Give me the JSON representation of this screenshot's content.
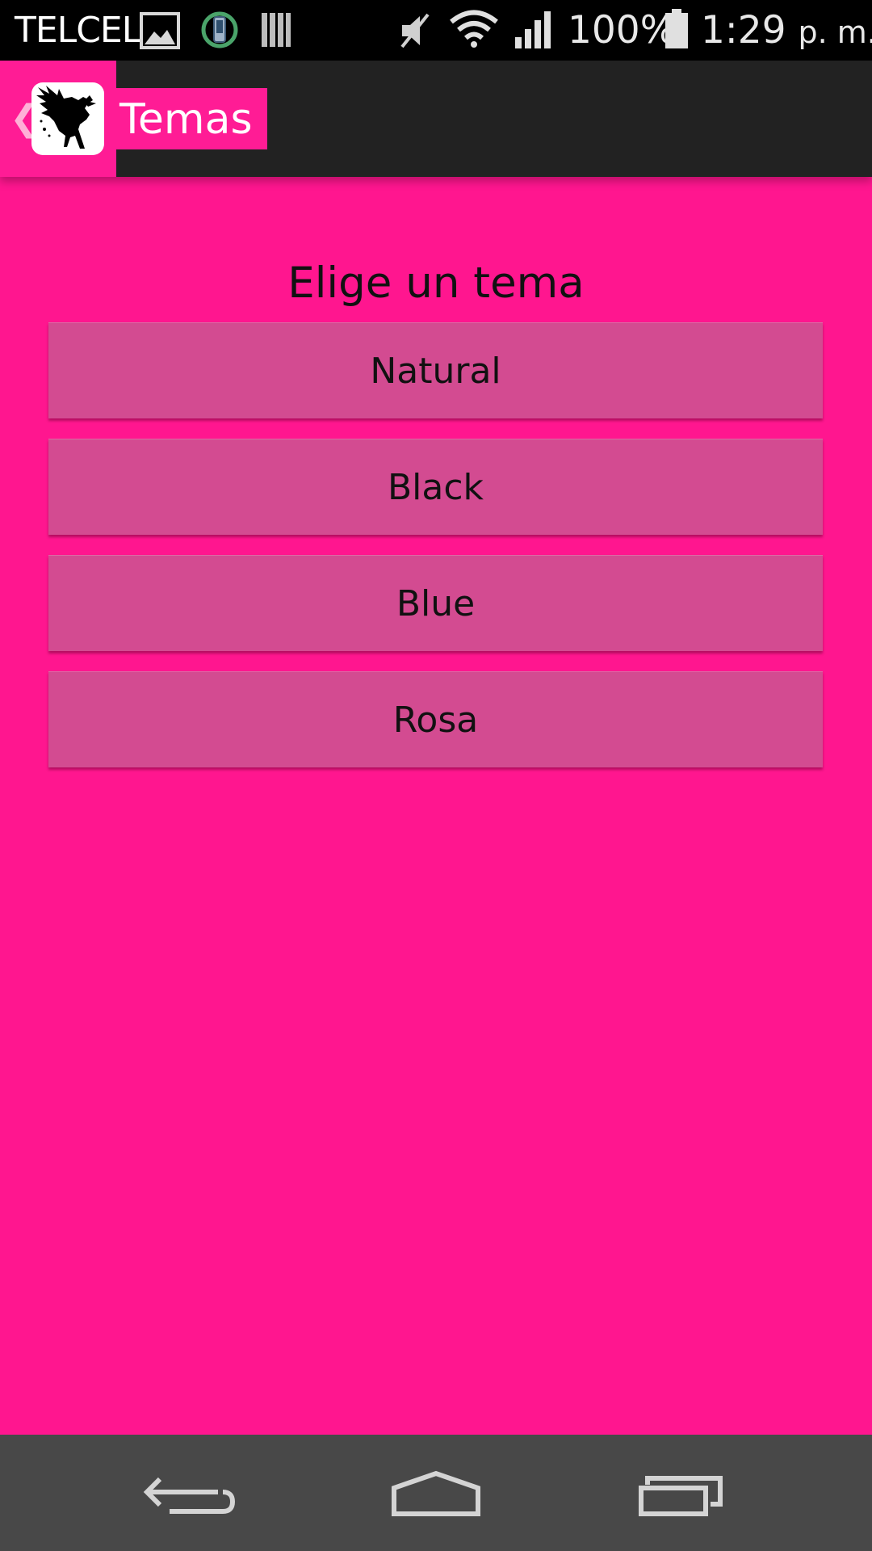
{
  "status_bar": {
    "carrier": "TELCEL",
    "battery": "100%",
    "time": "1:29",
    "ampm": "p. m."
  },
  "action_bar": {
    "title": "Temas",
    "back_glyph": "❮",
    "icons": {
      "up": "chevron-left-icon",
      "logo": "crow-logo"
    }
  },
  "main": {
    "heading": "Elige un tema",
    "themes": [
      {
        "label": "Natural"
      },
      {
        "label": "Black"
      },
      {
        "label": "Blue"
      },
      {
        "label": "Rosa"
      }
    ]
  },
  "nav_bar": {
    "buttons": [
      "back-icon",
      "home-icon",
      "recents-icon"
    ]
  },
  "colors": {
    "background": "#ff168f",
    "action_bar": "#222222",
    "button": "#d34b91",
    "nav_bar": "#484848"
  }
}
